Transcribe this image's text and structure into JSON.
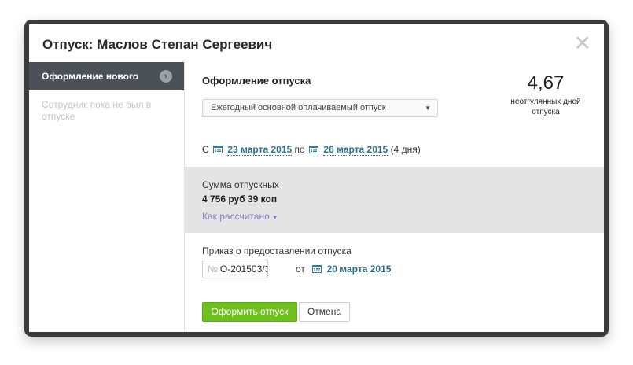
{
  "window": {
    "title": "Отпуск: Маслов Степан Сергеевич",
    "close_icon": "close-icon"
  },
  "sidebar": {
    "active_item": "Оформление нового",
    "note": "Сотрудник пока не был в отпуске"
  },
  "main": {
    "title": "Оформление отпуска",
    "vacation_type": "Ежегодный основной оплачиваемый отпуск",
    "days_left": {
      "value": "4,67",
      "label": "неотгулянных дней отпуска"
    },
    "dates": {
      "prefix": "С",
      "from": "23 марта 2015",
      "between": "по",
      "to": "26 марта 2015",
      "duration": "(4 дня)"
    },
    "sum": {
      "label": "Сумма отпускных",
      "value": "4 756 руб 39 коп",
      "calc_link": "Как рассчитано"
    },
    "order": {
      "label": "Приказ о предоставлении отпуска",
      "number_prefix": "№",
      "number": "О-201503/3",
      "from_label": "от",
      "date": "20 марта 2015"
    },
    "buttons": {
      "submit": "Оформить отпуск",
      "cancel": "Отмена"
    }
  },
  "colors": {
    "accent_green": "#6fbf1f",
    "link_teal": "#2d6f87",
    "link_purple": "#8a7bc4",
    "sidebar_active": "#4b5157"
  }
}
